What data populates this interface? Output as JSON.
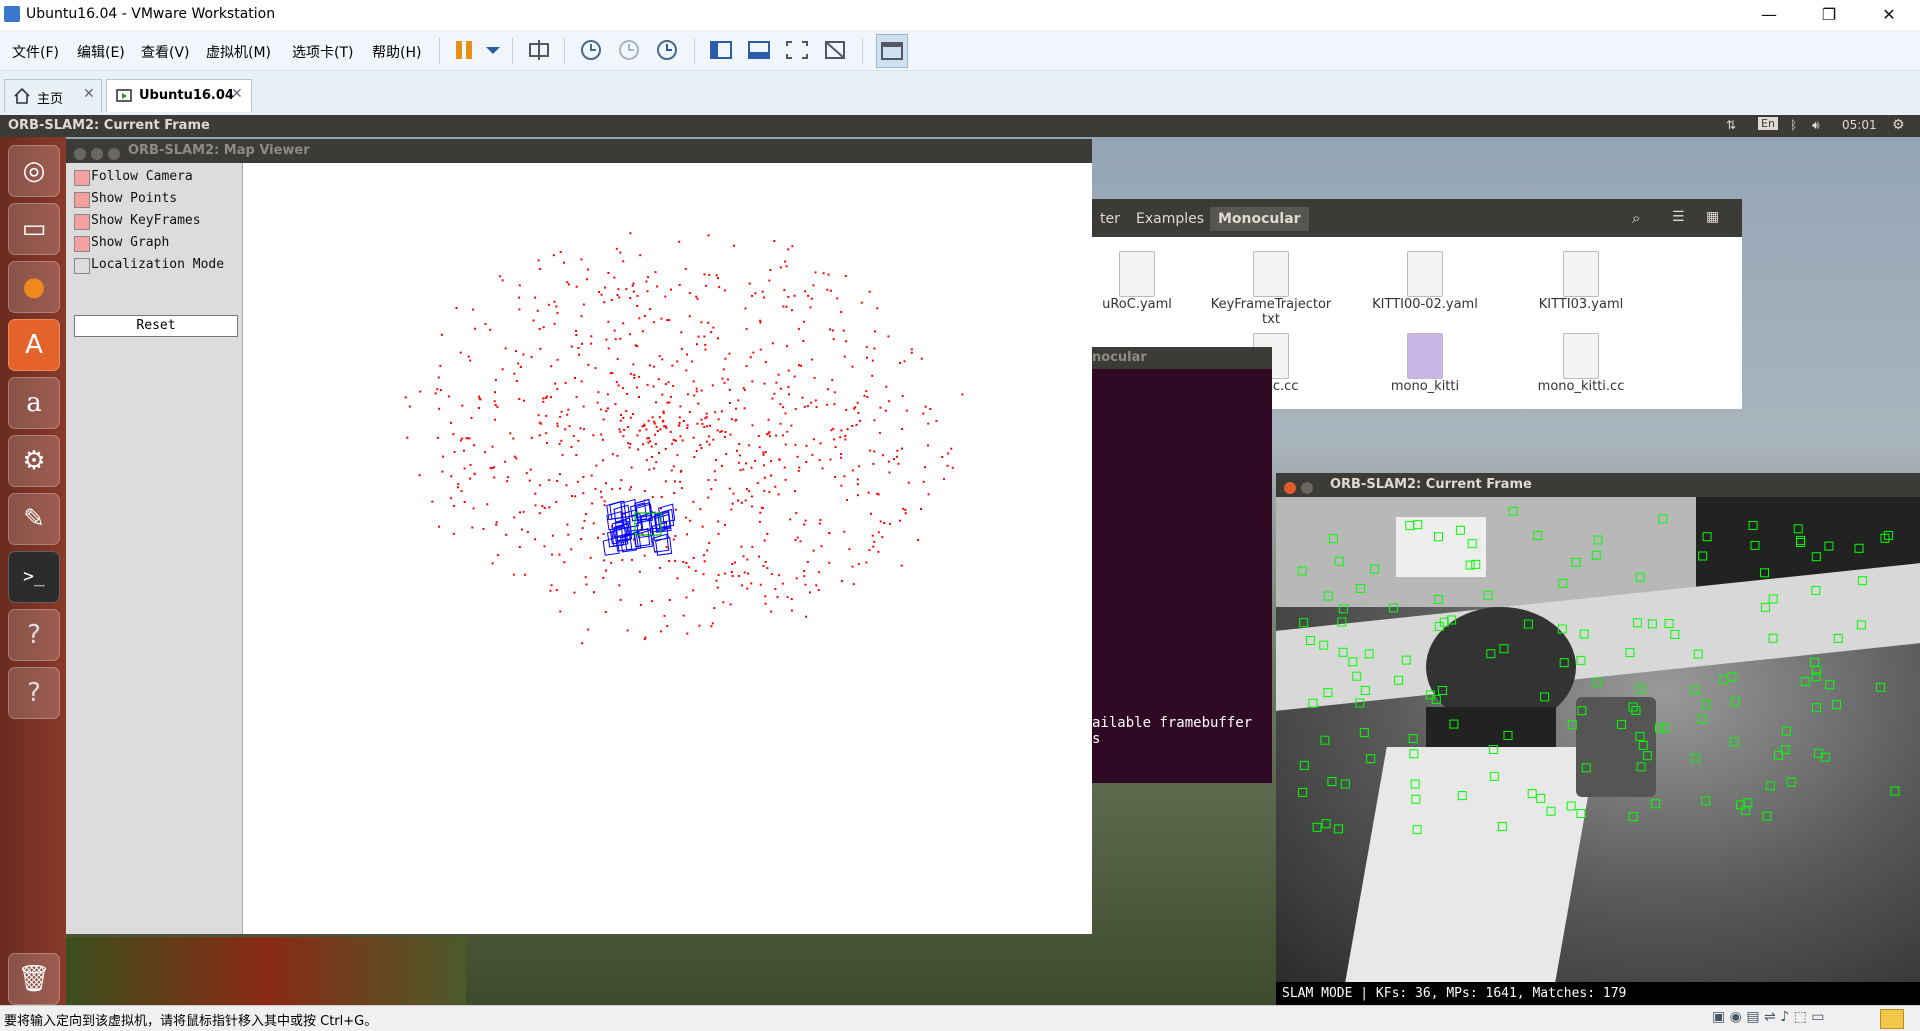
{
  "host": {
    "window_title": "Ubuntu16.04 - VMware Workstation",
    "menu": [
      "文件(F)",
      "编辑(E)",
      "查看(V)",
      "虚拟机(M)",
      "选项卡(T)",
      "帮助(H)"
    ],
    "tabs": [
      {
        "label": "主页",
        "active": false
      },
      {
        "label": "Ubuntu16.04",
        "active": true
      }
    ],
    "status_message": "要将输入定向到该虚拟机，请将鼠标指针移入其中或按 Ctrl+G。"
  },
  "guest": {
    "top_panel_title": "ORB-SLAM2: Current Frame",
    "indicators": {
      "keyboard": "En",
      "clock": "05:01"
    },
    "map_viewer": {
      "title": "ORB-SLAM2: Map Viewer",
      "options": [
        {
          "label": "Follow Camera",
          "checked": true
        },
        {
          "label": "Show Points",
          "checked": true
        },
        {
          "label": "Show KeyFrames",
          "checked": true
        },
        {
          "label": "Show Graph",
          "checked": true
        },
        {
          "label": "Localization Mode",
          "checked": false
        }
      ],
      "reset_label": "Reset",
      "colors": {
        "points": "#ff0000",
        "keyframes": "#0000ff",
        "current_camera": "#00c000"
      }
    },
    "file_manager": {
      "breadcrumbs": [
        "ter",
        "Examples",
        "Monocular"
      ],
      "files": [
        "uRoC.yaml",
        "KeyFrameTrajector txt",
        "KITTI00-02.yaml",
        "KITTI03.yaml",
        "euroc.cc",
        "mono_kitti",
        "mono_kitti.cc"
      ]
    },
    "terminal": {
      "title_fragment": "nocular",
      "lines": [
        "ailable framebuffer",
        "s"
      ]
    },
    "current_frame": {
      "title": "ORB-SLAM2: Current Frame",
      "status_text": "SLAM MODE |  KFs: 36, MPs: 1641, Matches: 179",
      "feature_color": "#00ff00"
    }
  }
}
